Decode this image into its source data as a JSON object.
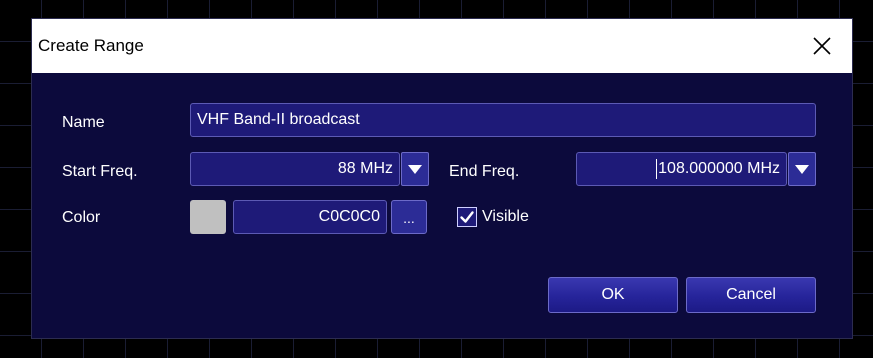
{
  "dialog": {
    "title": "Create Range",
    "close_icon": "close-icon"
  },
  "form": {
    "name_label": "Name",
    "name_value": "VHF Band-II broadcast",
    "start_label": "Start Freq.",
    "start_value": "88 MHz",
    "end_label": "End Freq.",
    "end_value": "108.000000 MHz",
    "color_label": "Color",
    "color_value": "C0C0C0",
    "color_swatch": "#C0C0C0",
    "ellipsis_label": "...",
    "visible_label": "Visible",
    "visible_checked": true
  },
  "buttons": {
    "ok_label": "OK",
    "cancel_label": "Cancel"
  },
  "theme": {
    "dialog_bg": "#0c0a3c",
    "field_bg": "#1e1a78",
    "field_border": "#5c5ab4",
    "button_bg": "#2c2c96"
  }
}
